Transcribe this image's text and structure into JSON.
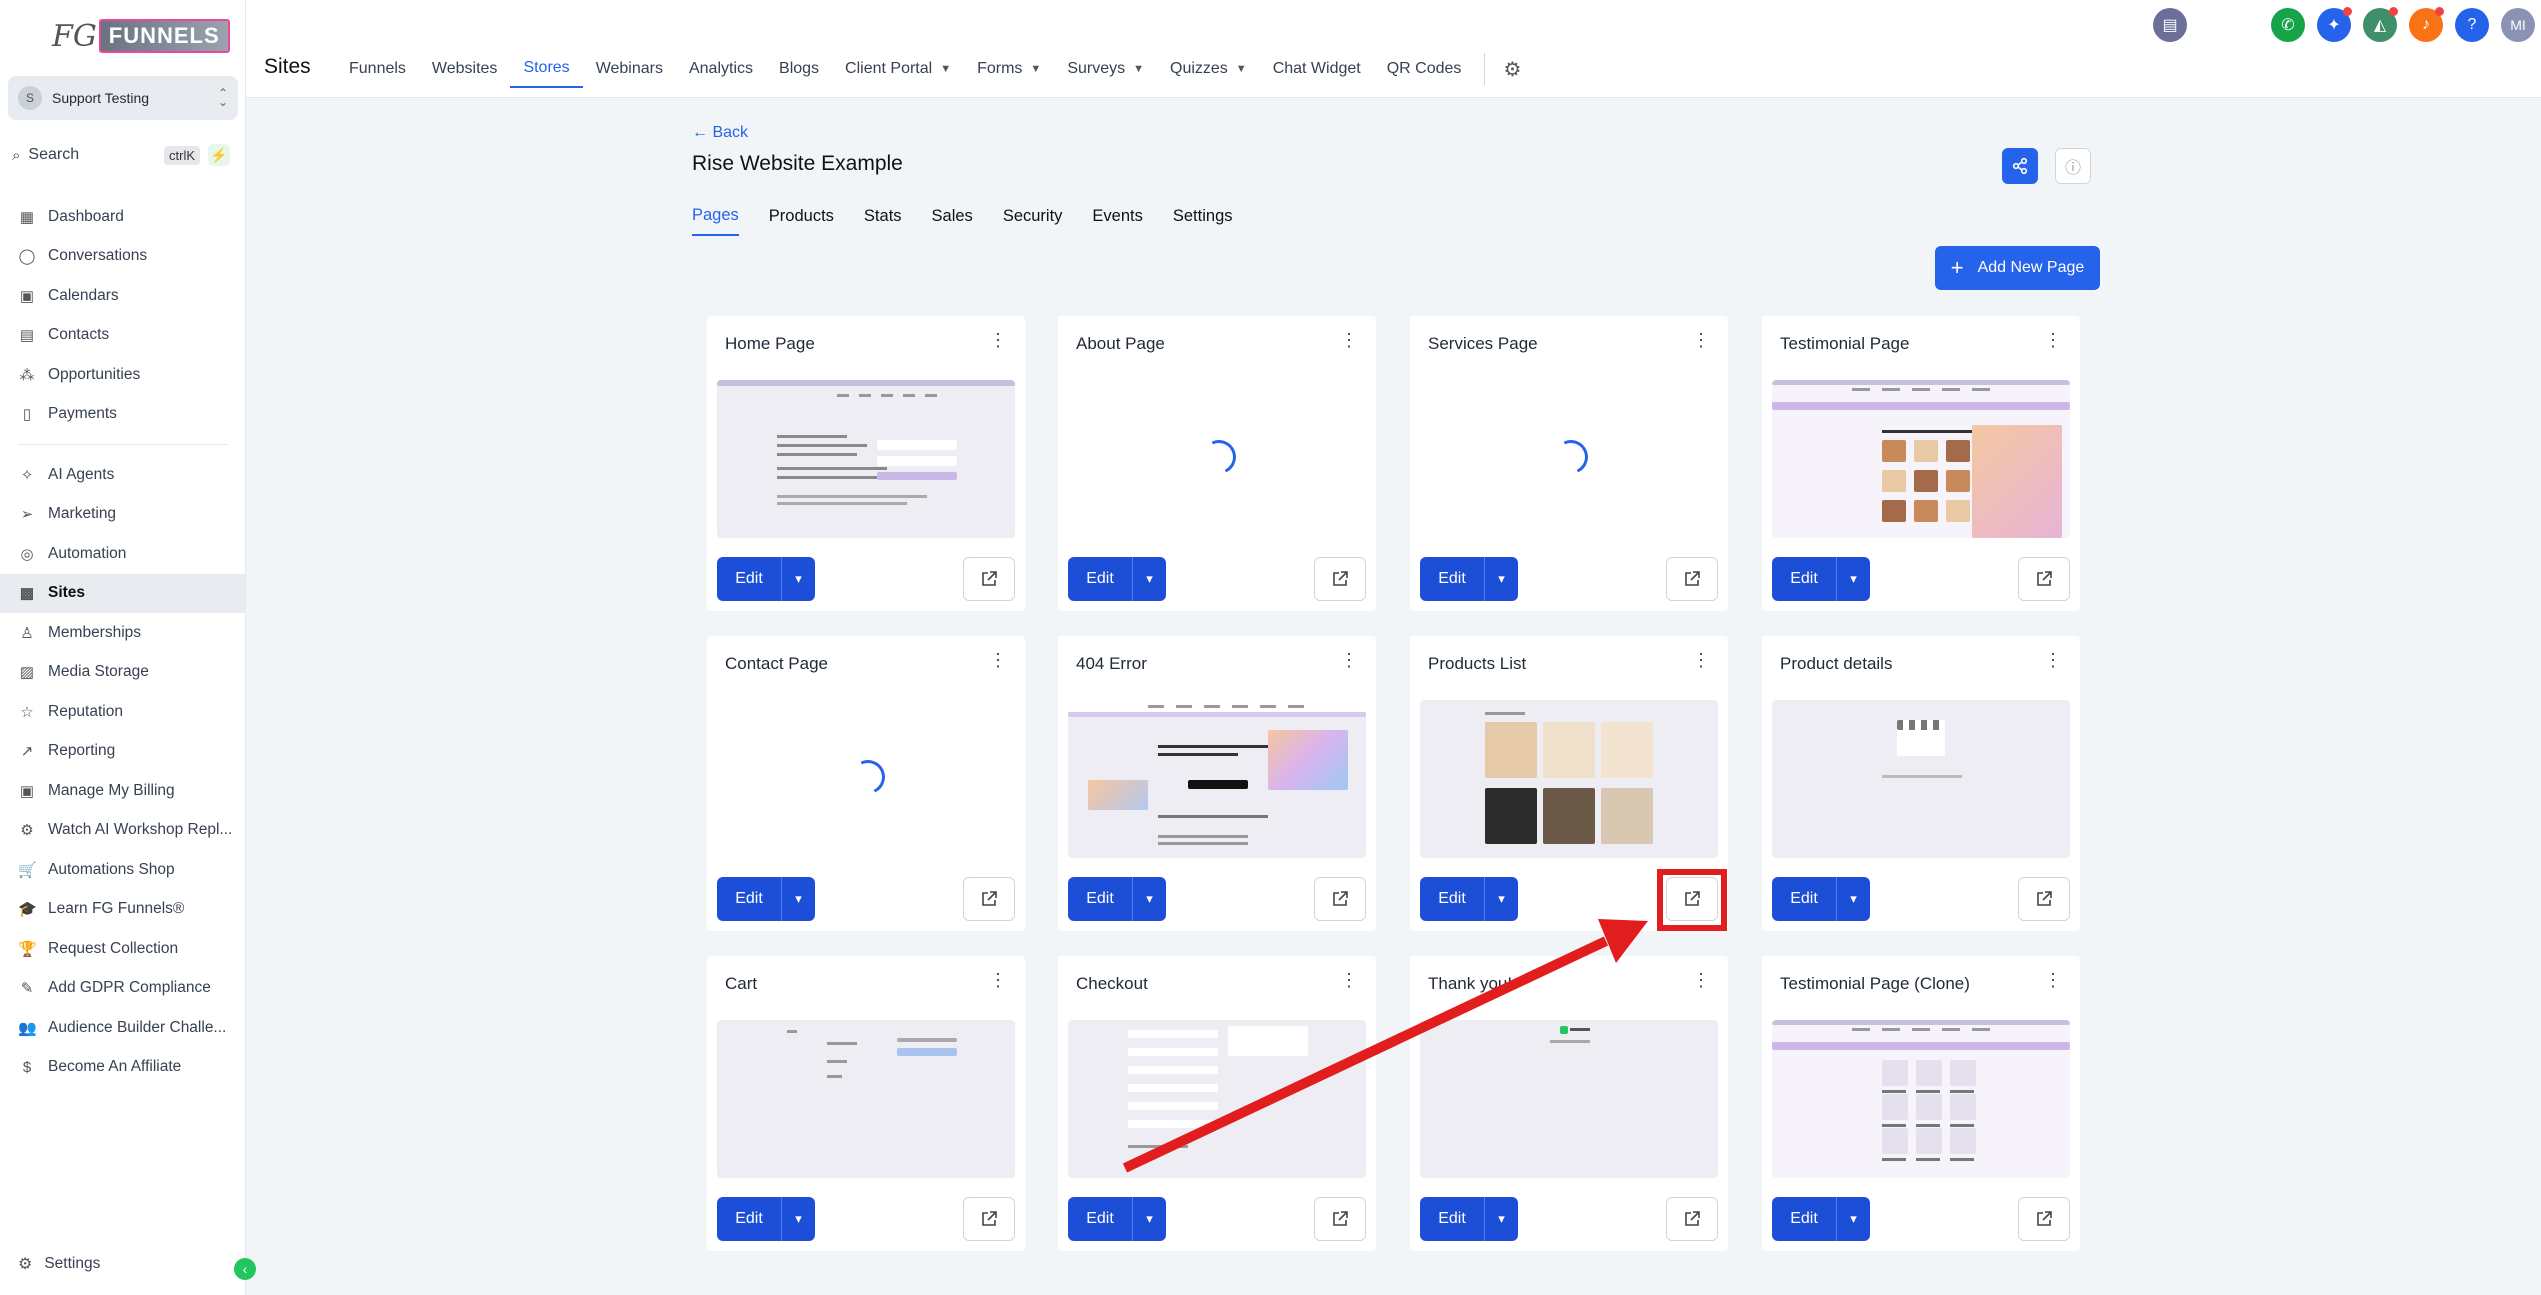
{
  "brand": {
    "logo_prefix": "FG",
    "logo_word": "FUNNELS",
    "registered": "®"
  },
  "account": {
    "initial": "S",
    "name": "Support Testing"
  },
  "search": {
    "label": "Search",
    "shortcut": "ctrlK"
  },
  "sidebar": {
    "items": [
      {
        "label": "Dashboard",
        "icon": "grid-icon",
        "glyph": "▦"
      },
      {
        "label": "Conversations",
        "icon": "chat-icon",
        "glyph": "◯"
      },
      {
        "label": "Calendars",
        "icon": "calendar-icon",
        "glyph": "▣"
      },
      {
        "label": "Contacts",
        "icon": "contacts-icon",
        "glyph": "▤"
      },
      {
        "label": "Opportunities",
        "icon": "opportunities-icon",
        "glyph": "⁂"
      },
      {
        "label": "Payments",
        "icon": "payments-icon",
        "glyph": "▯"
      },
      {
        "label": "AI Agents",
        "icon": "ai-agents-icon",
        "glyph": "✧"
      },
      {
        "label": "Marketing",
        "icon": "send-icon",
        "glyph": "➢"
      },
      {
        "label": "Automation",
        "icon": "automation-icon",
        "glyph": "◎"
      },
      {
        "label": "Sites",
        "icon": "sites-icon",
        "glyph": "▩"
      },
      {
        "label": "Memberships",
        "icon": "memberships-icon",
        "glyph": "♙"
      },
      {
        "label": "Media Storage",
        "icon": "media-icon",
        "glyph": "▨"
      },
      {
        "label": "Reputation",
        "icon": "star-icon",
        "glyph": "☆"
      },
      {
        "label": "Reporting",
        "icon": "reporting-icon",
        "glyph": "↗"
      },
      {
        "label": "Manage My Billing",
        "icon": "billing-icon",
        "glyph": "▣"
      },
      {
        "label": "Watch AI Workshop Repl...",
        "icon": "robot-icon",
        "glyph": "⚙"
      },
      {
        "label": "Automations Shop",
        "icon": "cart-icon",
        "glyph": "🛒"
      },
      {
        "label": "Learn FG Funnels®",
        "icon": "graduation-icon",
        "glyph": "🎓"
      },
      {
        "label": "Request Collection",
        "icon": "trophy-icon",
        "glyph": "🏆"
      },
      {
        "label": "Add GDPR Compliance",
        "icon": "gdpr-icon",
        "glyph": "✎"
      },
      {
        "label": "Audience Builder Challe...",
        "icon": "users-icon",
        "glyph": "👥"
      },
      {
        "label": "Become An Affiliate",
        "icon": "dollar-icon",
        "glyph": "$"
      }
    ],
    "active": "Sites",
    "settings_label": "Settings"
  },
  "topbar": {
    "section_title": "Sites",
    "tabs": [
      {
        "label": "Funnels",
        "caret": false
      },
      {
        "label": "Websites",
        "caret": false
      },
      {
        "label": "Stores",
        "caret": false,
        "active": true
      },
      {
        "label": "Webinars",
        "caret": false
      },
      {
        "label": "Analytics",
        "caret": false
      },
      {
        "label": "Blogs",
        "caret": false
      },
      {
        "label": "Client Portal",
        "caret": true
      },
      {
        "label": "Forms",
        "caret": true
      },
      {
        "label": "Surveys",
        "caret": true
      },
      {
        "label": "Quizzes",
        "caret": true
      },
      {
        "label": "Chat Widget",
        "caret": false
      },
      {
        "label": "QR Codes",
        "caret": false
      }
    ],
    "user_initials": "MI"
  },
  "main": {
    "back_label": "Back",
    "title": "Rise Website Example",
    "tabs": [
      "Pages",
      "Products",
      "Stats",
      "Sales",
      "Security",
      "Events",
      "Settings"
    ],
    "active_tab": "Pages",
    "add_label": "Add New Page",
    "edit_label": "Edit",
    "pages": [
      {
        "title": "Home Page",
        "preview": "site"
      },
      {
        "title": "About Page",
        "preview": "loading"
      },
      {
        "title": "Services Page",
        "preview": "loading"
      },
      {
        "title": "Testimonial Page",
        "preview": "testimonial"
      },
      {
        "title": "Contact Page",
        "preview": "loading"
      },
      {
        "title": "404 Error",
        "preview": "error"
      },
      {
        "title": "Products List",
        "preview": "products"
      },
      {
        "title": "Product details",
        "preview": "store"
      },
      {
        "title": "Cart",
        "preview": "cart"
      },
      {
        "title": "Checkout",
        "preview": "checkout"
      },
      {
        "title": "Thank you!",
        "preview": "thanks"
      },
      {
        "title": "Testimonial Page (Clone)",
        "preview": "testimonial2"
      }
    ]
  },
  "colors": {
    "accent": "#2563eb",
    "highlight": "#e11d1d"
  }
}
